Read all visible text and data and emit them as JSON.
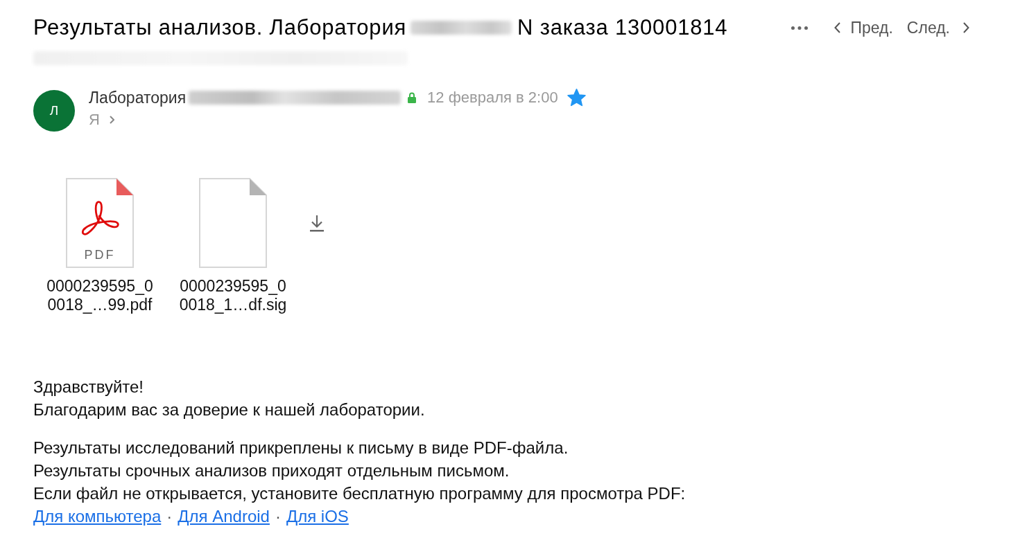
{
  "toolbar": {
    "prev": "Пред.",
    "next": "След."
  },
  "message": {
    "subject_parts": [
      {
        "kind": "text",
        "text": "Результаты анализов. Лаборатория"
      },
      {
        "kind": "redacted"
      },
      {
        "kind": "text",
        "text": "N заказа 130001814"
      }
    ],
    "subject_second_line": [
      {
        "kind": "redacted"
      }
    ],
    "sender": {
      "avatar_letter": "Л",
      "name_parts": [
        {
          "kind": "text",
          "text": "Лаборатория"
        },
        {
          "kind": "redacted"
        }
      ],
      "secure": true
    },
    "date": "12 февраля в 2:00",
    "starred": true,
    "recipient": "Я",
    "attachments": [
      {
        "kind": "pdf",
        "type_label": "PDF",
        "name_lines": [
          "0000239595_0",
          "0018_…99.pdf"
        ]
      },
      {
        "kind": "file",
        "name_lines": [
          "0000239595_0",
          "0018_1…df.sig"
        ]
      }
    ],
    "body": {
      "paragraphs": [
        {
          "lines": [
            "Здравствуйте!",
            "Благодарим вас за доверие к нашей лаборатории."
          ]
        },
        {
          "lines": [
            "Результаты исследований прикреплены к письму в виде PDF-файла.",
            "Результаты срочных анализов приходят отдельным письмом.",
            "Если файл не открывается, установите бесплатную программу для просмотра PDF:"
          ],
          "links": [
            {
              "kind": "link",
              "text": "Для компьютера"
            },
            {
              "kind": "separator",
              "text": "·"
            },
            {
              "kind": "link",
              "text": "Для Android"
            },
            {
              "kind": "separator",
              "text": "·"
            },
            {
              "kind": "link",
              "text": "Для iOS"
            }
          ]
        }
      ]
    }
  }
}
